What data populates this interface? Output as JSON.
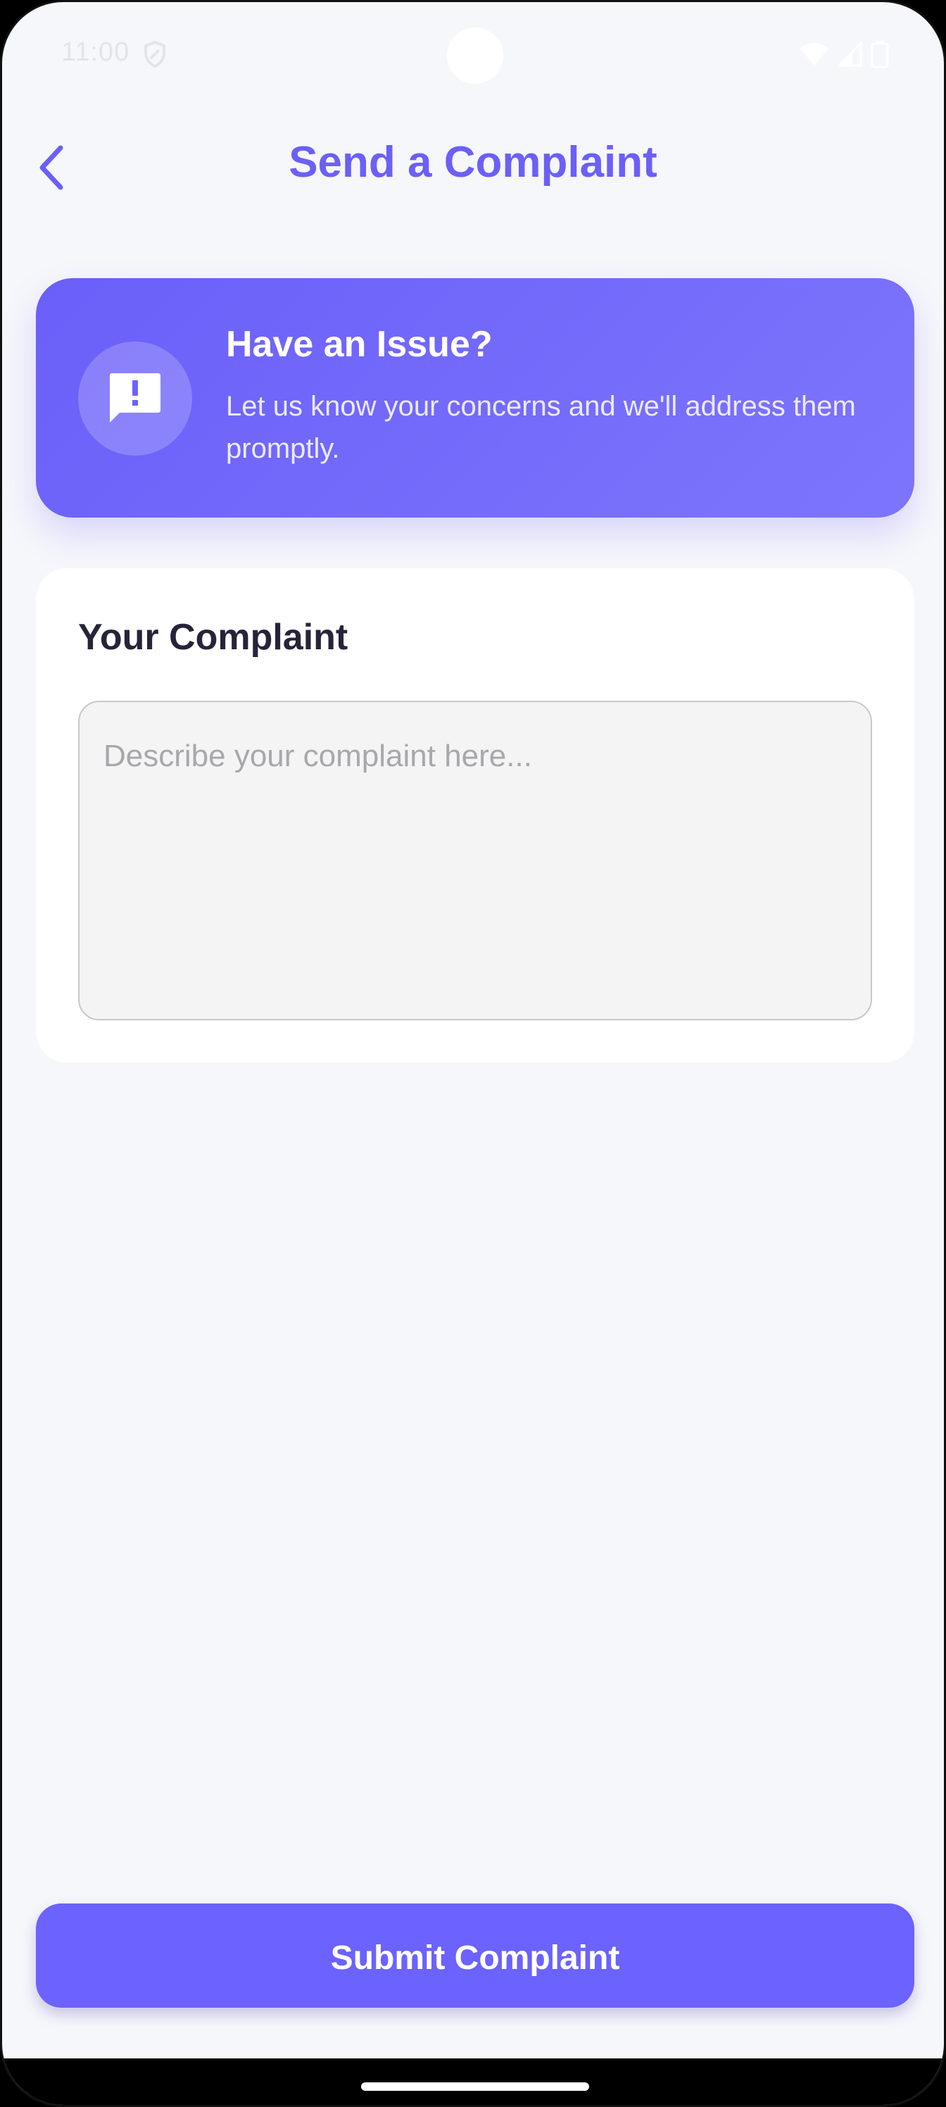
{
  "status_bar": {
    "time": "11:00",
    "icons": [
      "shield-icon",
      "wifi-icon",
      "signal-icon",
      "battery-icon"
    ]
  },
  "header": {
    "title": "Send a Complaint",
    "back_icon": "chevron-left-icon"
  },
  "hero": {
    "title": "Have an Issue?",
    "subtitle": "Let us know your concerns and we'll address them promptly.",
    "icon": "feedback-alert-icon"
  },
  "form": {
    "label": "Your Complaint",
    "complaint_value": "",
    "complaint_placeholder": "Describe your complaint here..."
  },
  "actions": {
    "submit_label": "Submit Complaint"
  },
  "colors": {
    "accent": "#6c5ff8",
    "background": "#f6f7fb",
    "text_dark": "#25243a"
  }
}
